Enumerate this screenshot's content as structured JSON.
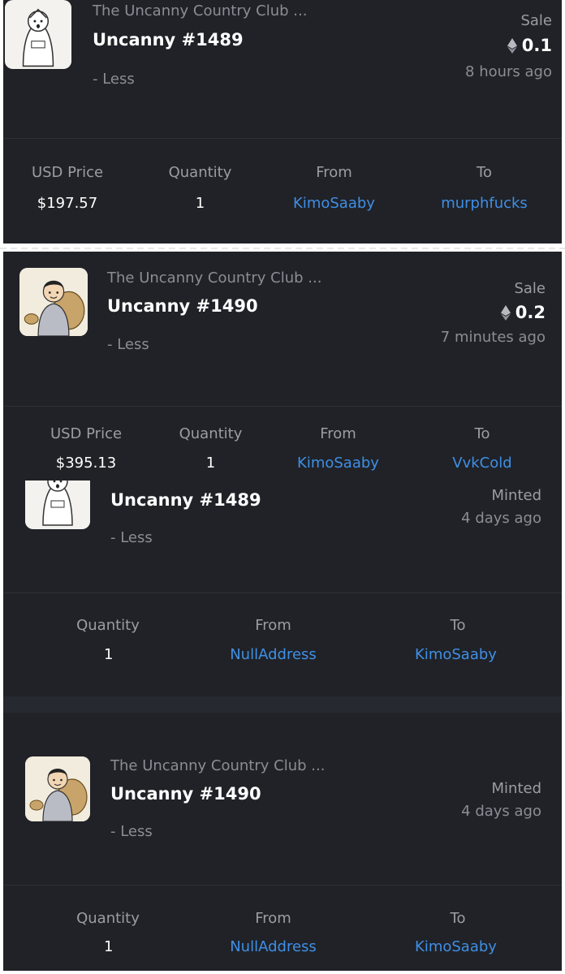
{
  "cards": [
    {
      "collection": "The Uncanny Country Club ...",
      "title": "Uncanny #1489",
      "less": "- Less",
      "event": "Sale",
      "price": "0.1",
      "time": "8 hours ago",
      "headers": [
        "USD Price",
        "Quantity",
        "From",
        "To"
      ],
      "values": [
        "$197.57",
        "1",
        "KimoSaaby",
        "murphfucks"
      ]
    },
    {
      "collection": "The Uncanny Country Club ...",
      "title": "Uncanny #1490",
      "less": "- Less",
      "event": "Sale",
      "price": "0.2",
      "time": "7 minutes ago",
      "headers": [
        "USD Price",
        "Quantity",
        "From",
        "To"
      ],
      "values": [
        "$395.13",
        "1",
        "KimoSaaby",
        "VvkCold"
      ]
    },
    {
      "title": "Uncanny #1489",
      "less": "- Less",
      "event": "Minted",
      "time": "4 days ago",
      "headers": [
        "Quantity",
        "From",
        "To"
      ],
      "values": [
        "1",
        "NullAddress",
        "KimoSaaby"
      ]
    },
    {
      "collection": "The Uncanny Country Club ...",
      "title": "Uncanny #1490",
      "less": "- Less",
      "event": "Minted",
      "time": "4 days ago",
      "headers": [
        "Quantity",
        "From",
        "To"
      ],
      "values": [
        "1",
        "NullAddress",
        "KimoSaaby"
      ]
    }
  ],
  "icons": {
    "currency": "ethereum-icon",
    "thumb_1489": "nft-thumbnail-hooded-figure",
    "thumb_1490": "nft-thumbnail-suited-man-with-sack"
  },
  "colors": {
    "background": "#202227",
    "link": "#3f8fe6",
    "muted": "#8a8d94",
    "text": "#ffffff"
  }
}
